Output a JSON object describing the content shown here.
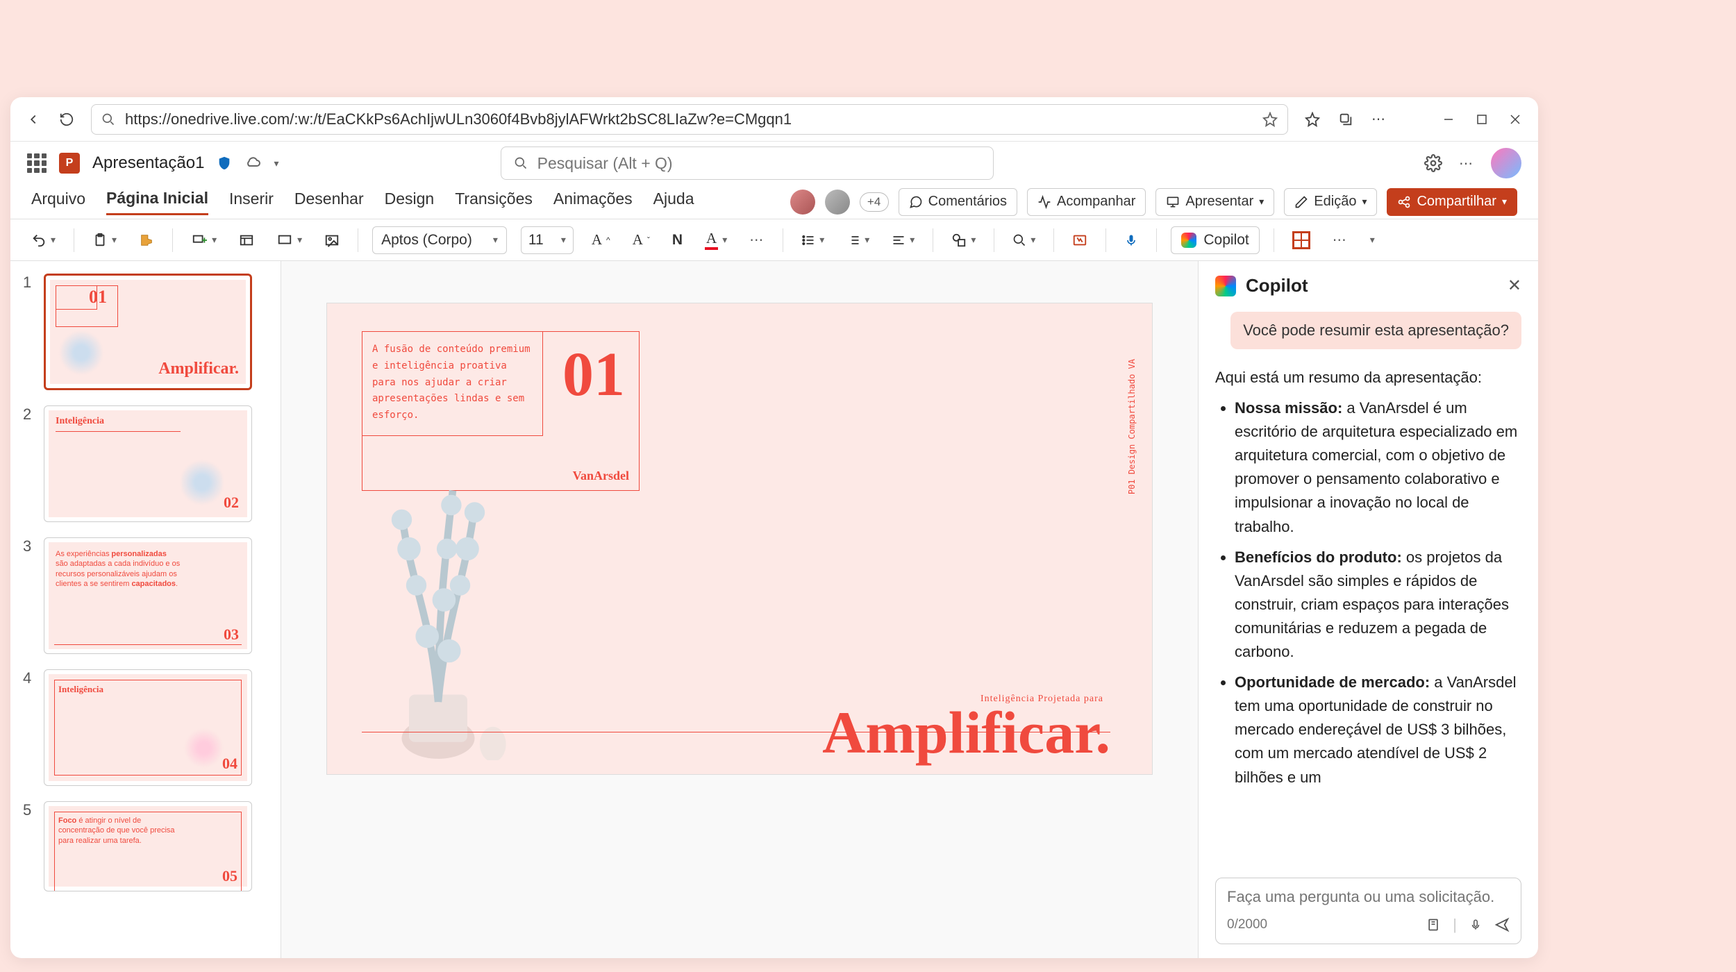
{
  "browser": {
    "url": "https://onedrive.live.com/:w:/t/EaCKkPs6AchIjwULn3060f4Bvb8jylAFWrkt2bSC8LIaZw?e=CMgqn1"
  },
  "app": {
    "title": "Apresentação1",
    "search_placeholder": "Pesquisar (Alt + Q)"
  },
  "tabs": {
    "arquivo": "Arquivo",
    "pagina": "Página Inicial",
    "inserir": "Inserir",
    "desenhar": "Desenhar",
    "design": "Design",
    "transicoes": "Transições",
    "animacoes": "Animações",
    "ajuda": "Ajuda",
    "extra_count": "+4",
    "comentarios": "Comentários",
    "acompanhar": "Acompanhar",
    "apresentar": "Apresentar",
    "edicao": "Edição",
    "compartilhar": "Compartilhar"
  },
  "toolbar": {
    "font": "Aptos (Corpo)",
    "size": "11",
    "bold": "N",
    "copilot": "Copilot"
  },
  "slide": {
    "box_text": "A fusão de conteúdo premium e inteligência proativa para nos ajudar a criar apresentações lindas e sem esforço.",
    "num": "01",
    "brand": "VanArsdel",
    "subtitle": "Inteligência Projetada para",
    "title": "Amplificar.",
    "sidelabel": "P01  Design Compartilhado VA"
  },
  "thumbs": {
    "t1": {
      "num": "01",
      "title": "Amplificar."
    },
    "t2": {
      "num": "02",
      "title": "Inteligência"
    },
    "t3": {
      "num": "03",
      "text_a": "As experiências",
      "text_b": "personalizadas",
      "text_c": " são adaptadas a cada indivíduo e os recursos personalizáveis ajudam os clientes a se sentirem ",
      "text_d": "capacitados",
      "text_e": "."
    },
    "t4": {
      "num": "04",
      "title": "Inteligência"
    },
    "t5": {
      "num": "05",
      "text_a": "Foco",
      "text_b": " é atingir o nível de concentração de que você precisa para realizar uma tarefa."
    }
  },
  "copilot": {
    "title": "Copilot",
    "prompt": "Você pode resumir esta apresentação?",
    "intro": "Aqui está um resumo da apresentação:",
    "b1_t": "Nossa missão:",
    "b1_b": " a VanArsdel é um escritório de arquitetura especializado em arquitetura comercial, com o objetivo de promover o pensamento colaborativo e impulsionar a inovação no local de trabalho.",
    "b2_t": "Benefícios do produto:",
    "b2_b": " os projetos da VanArsdel são simples e rápidos de construir, criam espaços para interações comunitárias e reduzem a pegada de carbono.",
    "b3_t": "Oportunidade de mercado:",
    "b3_b": " a VanArsdel tem uma oportunidade de construir no mercado endereçável de US$ 3 bilhões, com um mercado atendível de US$ 2 bilhões e um",
    "input_placeholder": "Faça uma pergunta ou uma solicitação.",
    "counter": "0/2000"
  }
}
